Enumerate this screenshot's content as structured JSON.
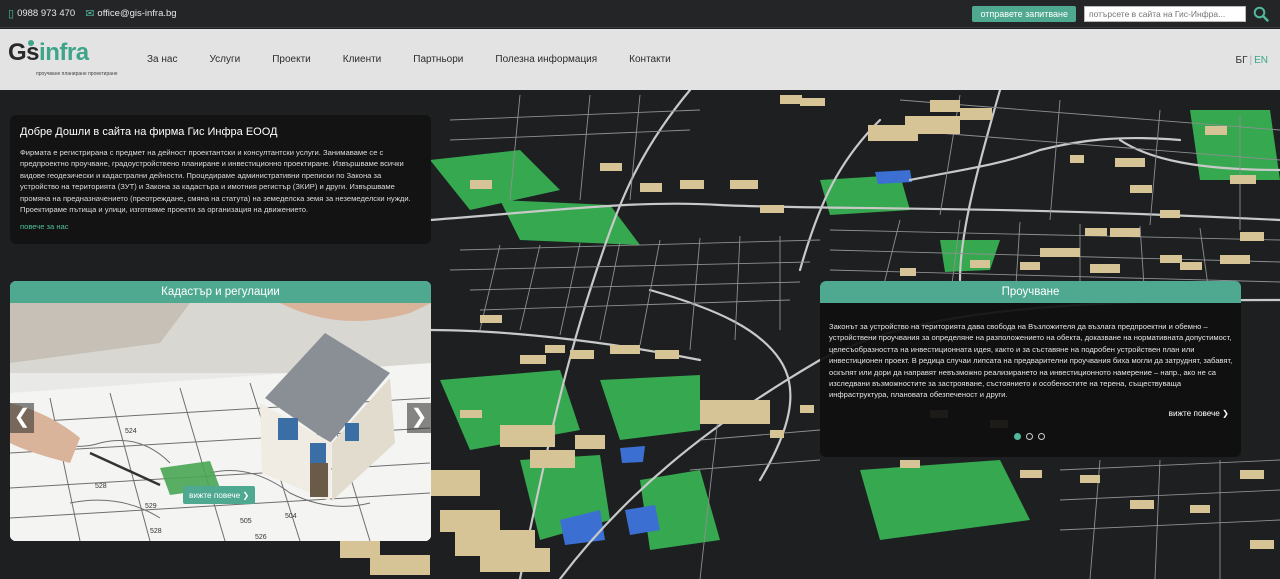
{
  "topbar": {
    "phone": "0988 973 470",
    "email": "office@gis-infra.bg",
    "request_button": "отправете запитване",
    "search_placeholder": "потърсете в сайта на Гис-Инфра..."
  },
  "logo": {
    "brand_g": "G",
    "brand_s": "s",
    "brand_infra": "infra",
    "tagline": "проучване планиране проектиране"
  },
  "nav": {
    "items": [
      "За нас",
      "Услуги",
      "Проекти",
      "Клиенти",
      "Партньори",
      "Полезна информация",
      "Контакти"
    ],
    "lang_bg": "БГ",
    "lang_sep": "|",
    "lang_en": "EN"
  },
  "welcome": {
    "title": "Добре Дошли в сайта на фирма Гис Инфра ЕООД",
    "body": "Фирмата е регистрирана с предмет на дейност проектантски и консултантски услуги. Занимаваме се с предпроектно проучване, градоустройствено планиране и инвестиционно проектиране. Извършваме всички видове геодезически и кадастрални дейности. Процедираме административни преписки по Закона за устройство на територията (ЗУТ) и Закона за кадастъра и имотния регистър (ЗКИР) и други. Извършваме промяна на предназначението (преотреждане, смяна на статута) на земеделска земя за неземеделски нужди. Проектираме пътища и улици, изготвяме проекти за организация на движението.",
    "more": "повече за нас"
  },
  "slider": {
    "title": "Кадастър и регулации",
    "more": "вижте повече ❯",
    "prev": "❮",
    "next": "❯",
    "plot_labels": [
      "524",
      "528",
      "529",
      "528",
      "505",
      "504",
      "526"
    ]
  },
  "study": {
    "title": "Проучване",
    "body": "Законът за устройство на територията дава свобода на Възложителя да възлага предпроектни и обемно – устройствени проучвания за определяне на разположението на обекта, доказване на нормативната допустимост, целесъобразността на инвестиционната идея, както и за съставяне на подробен устройствен план или инвестиционен проект. В редица случаи липсата на предварителни проучвания биха могли да затруднят, забавят, оскъпят или дори да направят невъзможно реализирането на инвестиционното намерение – напр., ако не са изследвани възможностите за застрояване, състоянието и особеностите на терена, съществуваща инфраструктура, плановата обезпеченост и други.",
    "more": "вижте повече ❯",
    "dots": 3,
    "active_dot": 0
  },
  "colors": {
    "accent": "#4fa890",
    "link": "#4fc09f",
    "topbar_bg": "#232527",
    "nav_bg": "#ebebeb",
    "card_bg": "#121212",
    "map_bg": "#1c1e20",
    "map_green": "#38b455",
    "map_water": "#3a6fd0",
    "map_building": "#d8c49a"
  }
}
